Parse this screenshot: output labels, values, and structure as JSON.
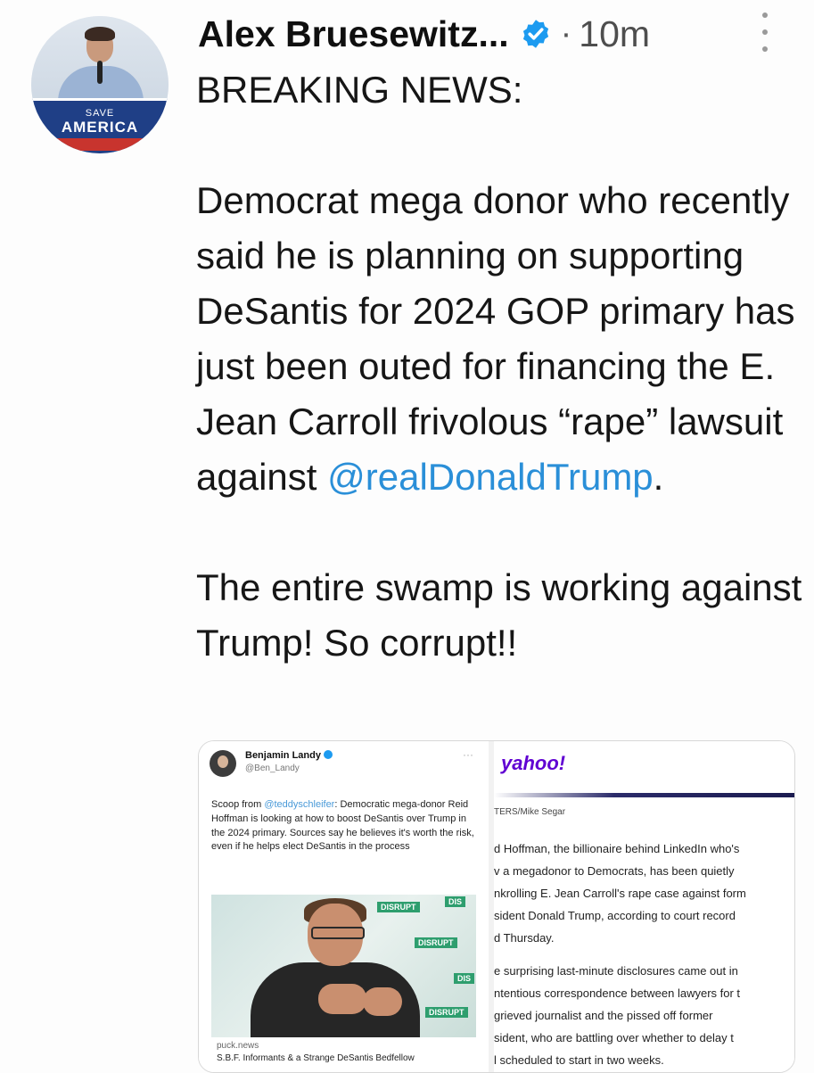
{
  "author": {
    "name": "Alex Bruesewitz...",
    "time_separator": "·",
    "time": "10m",
    "avatar_banner": {
      "line1": "SAVE",
      "line2": "AMERICA"
    }
  },
  "tweet": {
    "line1": "BREAKING NEWS:",
    "para2": "Democrat mega donor who recently said he is planning on supporting DeSantis for 2024 GOP primary has just been outed for financing the E. Jean Carroll frivolous “rape” lawsuit against ",
    "mention": "@realDonaldTrump",
    "para2_end": ".",
    "para3": "The entire swamp is working against Trump! So corrupt!!"
  },
  "card_left": {
    "name": "Benjamin Landy",
    "handle": "@Ben_Landy",
    "more": "···",
    "text_prefix": "Scoop from ",
    "text_mention": "@teddyschleifer",
    "text_body": ": Democratic mega-donor Reid Hoffman is looking at how to boost DeSantis over Trump in the 2024 primary. Sources say he believes it's worth the risk, even if he helps elect DeSantis in the process",
    "photo_signs": [
      "DISRUPT",
      "DIS",
      "DISRUPT",
      "DIS",
      "DISRUPT"
    ],
    "source": "puck.news",
    "title": "S.B.F. Informants & a Strange DeSantis Bedfellow"
  },
  "card_right": {
    "logo": "yahoo!",
    "credit": "TERS/Mike Segar",
    "lines": [
      "d Hoffman, the billionaire behind LinkedIn who's",
      "v a megadonor to Democrats, has been quietly",
      "nkrolling E. Jean Carroll's rape case against form",
      "sident Donald Trump, according to court record",
      "d Thursday.",
      "",
      "e surprising last-minute disclosures came out in",
      "ntentious correspondence between lawyers for t",
      "grieved journalist and the pissed off former",
      "sident, who are battling over whether to delay t",
      "l scheduled to start in two weeks."
    ]
  },
  "colors": {
    "mention": "#2a8fd8",
    "verified": "#1d9bf0",
    "yahoo": "#6001d2"
  }
}
